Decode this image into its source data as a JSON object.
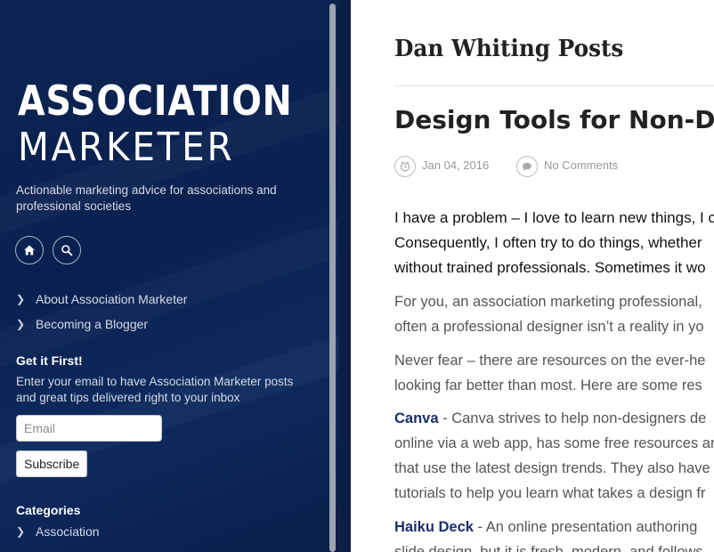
{
  "sidebar": {
    "logo_line1": "ASSOCIATION",
    "logo_line2": "MARKETER",
    "tagline": "Actionable marketing advice for associations and professional societies",
    "icons": {
      "home": "home-icon",
      "search": "search-icon"
    },
    "nav_items": [
      {
        "label": "About Association Marketer"
      },
      {
        "label": "Becoming a Blogger"
      }
    ],
    "signup": {
      "title": "Get it First!",
      "text": "Enter your email to have Association Marketer posts and great tips delivered right to your inbox",
      "email_placeholder": "Email",
      "email_value": "",
      "subscribe_label": "Subscribe"
    },
    "categories": {
      "title": "Categories",
      "items": [
        {
          "label": "Association"
        }
      ]
    }
  },
  "main": {
    "page_title": "Dan Whiting Posts",
    "post": {
      "title": "Design Tools for Non-Desig",
      "date": "Jan 04, 2016",
      "comments": "No Comments",
      "paragraphs": [
        {
          "lines": [
            "I have a problem – I love to learn new things, I c",
            "Consequently, I often try to do things, whether",
            "without trained professionals. Sometimes it wo"
          ]
        },
        {
          "lines": [
            "For you, an association marketing professional,",
            "often a professional designer isn’t a reality in yo"
          ]
        },
        {
          "lines": [
            "Never fear – there are resources on the ever-he",
            "looking far better than most. Here are some res"
          ]
        },
        {
          "tool": "Canva",
          "lines": [
            " - Canva strives to help non-designers de",
            "online via a web app, has some free resources ar",
            "that use the latest design trends. They also have",
            "tutorials to help you learn what takes a design fr"
          ]
        },
        {
          "tool": "Haiku Deck",
          "lines": [
            " - An online presentation authoring",
            "slide design, but it is fresh, modern, and follows"
          ]
        }
      ]
    }
  },
  "colors": {
    "sidebar_bg": "#0c2451",
    "link_blue": "#1b2f6e"
  }
}
